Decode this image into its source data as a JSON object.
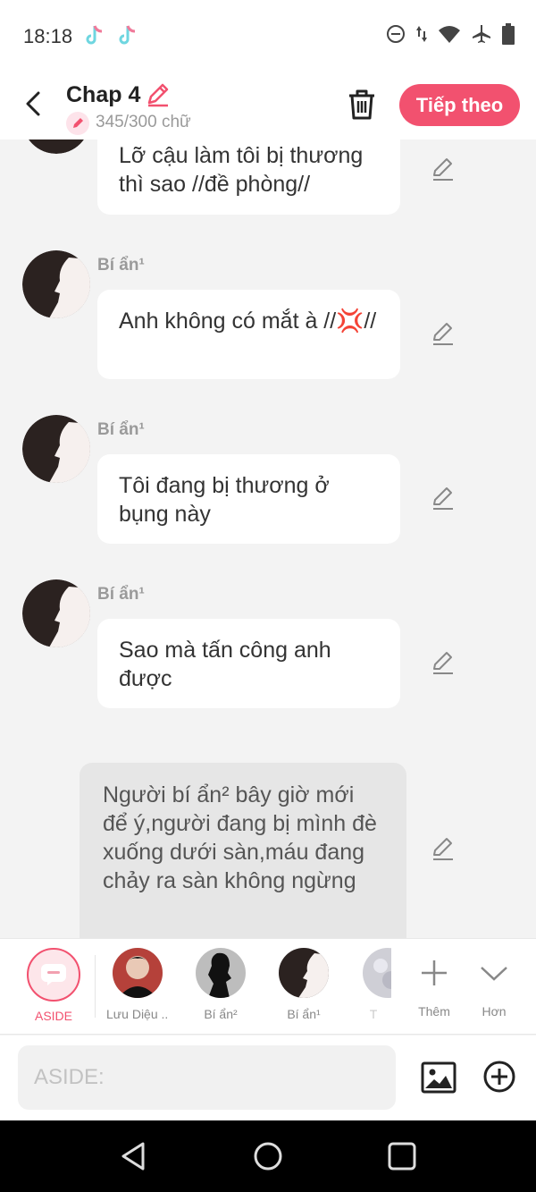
{
  "status": {
    "time": "18:18"
  },
  "header": {
    "title": "Chap 4",
    "word_count": "345/300 chữ",
    "next_label": "Tiếp theo"
  },
  "messages": [
    {
      "sender": "",
      "text": "Lỡ cậu làm tôi bị thương thì sao //đề phòng//"
    },
    {
      "sender": "Bí ẩn¹",
      "text": "Anh không có mắt à //💢//"
    },
    {
      "sender": "Bí ẩn¹",
      "text": "Tôi đang bị thương ở bụng này"
    },
    {
      "sender": "Bí ẩn¹",
      "text": "Sao mà tấn công anh được"
    }
  ],
  "aside_message": "Người bí ẩn² bây giờ mới để ý,người đang bị mình đè xuống dưới sàn,máu đang chảy ra sàn không ngừng",
  "characters": [
    {
      "label": "ASIDE",
      "icon": "aside-chat-icon"
    },
    {
      "label": "Lưu Diệu ...",
      "icon": "avatar"
    },
    {
      "label": "Bí ẩn²",
      "icon": "avatar"
    },
    {
      "label": "Bí ẩn¹",
      "icon": "avatar"
    },
    {
      "label": "T",
      "icon": "avatar"
    }
  ],
  "actions": {
    "add_label": "Thêm",
    "more_label": "Hơn"
  },
  "input": {
    "placeholder": "ASIDE:"
  },
  "colors": {
    "accent": "#f2516f",
    "background": "#f3f3f3",
    "aside_bubble": "#e6e6e6"
  }
}
